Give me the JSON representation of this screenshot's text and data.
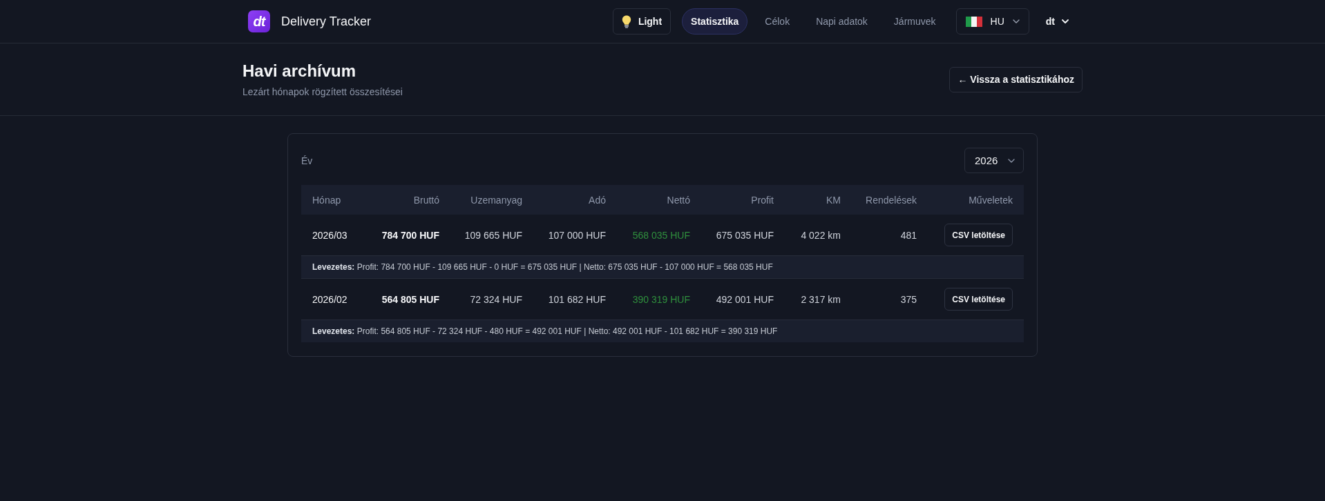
{
  "header": {
    "logo_text": "dt",
    "app_title": "Delivery Tracker",
    "theme_button": "Light",
    "nav": [
      {
        "label": "Statisztika",
        "selected": true
      },
      {
        "label": "Célok",
        "selected": false
      },
      {
        "label": "Napi adatok",
        "selected": false
      },
      {
        "label": "Jármuvek",
        "selected": false
      }
    ],
    "language": "HU",
    "user_menu": "dt"
  },
  "page_header": {
    "title": "Havi archívum",
    "subtitle": "Lezárt hónapok rögzített összesítései",
    "back_button": "← Vissza a statisztikához"
  },
  "archive": {
    "year_label": "Év",
    "year_select": "2026",
    "columns": [
      "Hónap",
      "Bruttó",
      "Uzemanyag",
      "Adó",
      "Nettó",
      "Profit",
      "KM",
      "Rendelések",
      "Műveletek"
    ],
    "rows": [
      {
        "cells": [
          "2026/03",
          "784 700 HUF",
          "109 665 HUF",
          "107 000 HUF",
          "568 035 HUF",
          "675 035 HUF",
          "4 022 km",
          "481"
        ],
        "action": "CSV letöltése",
        "explanation": "**Levezetes:** Profit: 784 700 HUF - 109 665 HUF - 0 HUF = 675 035 HUF | Netto: 675 035 HUF - 107 000 HUF = 568 035 HUF"
      },
      {
        "cells": [
          "2026/02",
          "564 805 HUF",
          "72 324 HUF",
          "101 682 HUF",
          "390 319 HUF",
          "492 001 HUF",
          "2 317 km",
          "375"
        ],
        "action": "CSV letöltése",
        "explanation": "**Levezetes:** Profit: 564 805 HUF - 72 324 HUF - 480 HUF = 492 001 HUF | Netto: 492 001 HUF - 101 682 HUF = 390 319 HUF"
      }
    ]
  }
}
